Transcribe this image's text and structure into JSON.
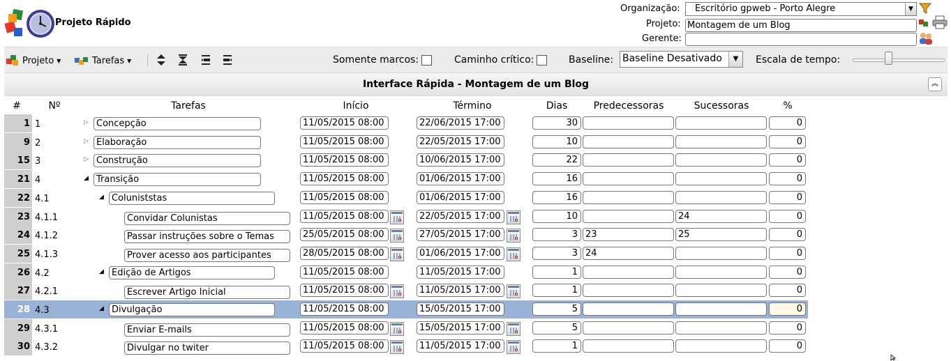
{
  "header": {
    "app_title": "Projeto Rápido",
    "organizacao_label": "Organização:",
    "organizacao_value": "Escritório gpweb - Porto Alegre",
    "projeto_label": "Projeto:",
    "projeto_value": "Montagem de um Blog",
    "gerente_label": "Gerente:",
    "gerente_value": ""
  },
  "toolbar": {
    "projeto_menu": "Projeto",
    "tarefas_menu": "Tarefas",
    "somente_marcos_label": "Somente marcos:",
    "caminho_critico_label": "Caminho crítico:",
    "baseline_label": "Baseline:",
    "baseline_value": "Baseline Desativado",
    "escala_label": "Escala de tempo:",
    "escala_level": 0.42
  },
  "panel_title": "Interface Rápida - Montagem de um Blog",
  "columns": {
    "idx": "#",
    "wbs": "Nº",
    "task": "Tarefas",
    "start": "Início",
    "end": "Término",
    "days": "Dias",
    "pred": "Predecessoras",
    "succ": "Sucessoras",
    "pct": "%"
  },
  "rows": [
    {
      "idx": "1",
      "wbs": "1",
      "name": "Concepção",
      "start": "11/05/2015 08:00",
      "end": "22/06/2015 17:00",
      "days": "30",
      "pred": "",
      "succ": "",
      "pct": "0",
      "level": 0,
      "expander": "collapsed",
      "cal": false,
      "selected": false
    },
    {
      "idx": "9",
      "wbs": "2",
      "name": "Elaboração",
      "start": "11/05/2015 08:00",
      "end": "22/05/2015 17:00",
      "days": "10",
      "pred": "",
      "succ": "",
      "pct": "0",
      "level": 0,
      "expander": "collapsed",
      "cal": false,
      "selected": false
    },
    {
      "idx": "15",
      "wbs": "3",
      "name": "Construção",
      "start": "11/05/2015 08:00",
      "end": "10/06/2015 17:00",
      "days": "22",
      "pred": "",
      "succ": "",
      "pct": "0",
      "level": 0,
      "expander": "collapsed",
      "cal": false,
      "selected": false
    },
    {
      "idx": "21",
      "wbs": "4",
      "name": "Transição",
      "start": "11/05/2015 08:00",
      "end": "01/06/2015 17:00",
      "days": "16",
      "pred": "",
      "succ": "",
      "pct": "0",
      "level": 0,
      "expander": "expanded",
      "cal": false,
      "selected": false
    },
    {
      "idx": "22",
      "wbs": "4.1",
      "name": "Coluniststas",
      "start": "11/05/2015 08:00",
      "end": "01/06/2015 17:00",
      "days": "16",
      "pred": "",
      "succ": "",
      "pct": "0",
      "level": 1,
      "expander": "expanded",
      "cal": false,
      "selected": false
    },
    {
      "idx": "23",
      "wbs": "4.1.1",
      "name": "Convidar Colunistas",
      "start": "11/05/2015 08:00",
      "end": "22/05/2015 17:00",
      "days": "10",
      "pred": "",
      "succ": "24",
      "pct": "0",
      "level": 2,
      "expander": "none",
      "cal": true,
      "selected": false
    },
    {
      "idx": "24",
      "wbs": "4.1.2",
      "name": "Passar instruções sobre o Temas",
      "start": "25/05/2015 08:00",
      "end": "27/05/2015 17:00",
      "days": "3",
      "pred": "23",
      "succ": "25",
      "pct": "0",
      "level": 2,
      "expander": "none",
      "cal": true,
      "selected": false
    },
    {
      "idx": "25",
      "wbs": "4.1.3",
      "name": "Prover acesso aos participantes",
      "start": "28/05/2015 08:00",
      "end": "01/06/2015 17:00",
      "days": "3",
      "pred": "24",
      "succ": "",
      "pct": "0",
      "level": 2,
      "expander": "none",
      "cal": true,
      "selected": false
    },
    {
      "idx": "26",
      "wbs": "4.2",
      "name": "Edição de Artigos",
      "start": "11/05/2015 08:00",
      "end": "11/05/2015 17:00",
      "days": "1",
      "pred": "",
      "succ": "",
      "pct": "0",
      "level": 1,
      "expander": "expanded",
      "cal": false,
      "selected": false
    },
    {
      "idx": "27",
      "wbs": "4.2.1",
      "name": "Escrever Artigo Inicial",
      "start": "11/05/2015 08:00",
      "end": "11/05/2015 17:00",
      "days": "1",
      "pred": "",
      "succ": "",
      "pct": "0",
      "level": 2,
      "expander": "none",
      "cal": true,
      "selected": false
    },
    {
      "idx": "28",
      "wbs": "4.3",
      "name": "Divulgação",
      "start": "11/05/2015 08:00",
      "end": "15/05/2015 17:00",
      "days": "5",
      "pred": "",
      "succ": "",
      "pct": "0",
      "level": 1,
      "expander": "expanded",
      "cal": false,
      "selected": true
    },
    {
      "idx": "29",
      "wbs": "4.3.1",
      "name": "Enviar E-mails",
      "start": "11/05/2015 08:00",
      "end": "15/05/2015 17:00",
      "days": "5",
      "pred": "",
      "succ": "",
      "pct": "0",
      "level": 2,
      "expander": "none",
      "cal": true,
      "selected": false
    },
    {
      "idx": "30",
      "wbs": "4.3.2",
      "name": "Divulgar no twiter",
      "start": "11/05/2015 08:00",
      "end": "11/05/2015 17:00",
      "days": "1",
      "pred": "",
      "succ": "",
      "pct": "0",
      "level": 2,
      "expander": "none",
      "cal": true,
      "selected": false
    }
  ],
  "icons": {
    "logo": "clock-puzzle-logo",
    "filter": "funnel-icon",
    "print": "printer-icon",
    "users": "users-icon"
  },
  "colors": {
    "selected_row": "#99b2d6",
    "row_index_bg": "#cfcfcf",
    "toolbar_bg": "#ececec"
  }
}
